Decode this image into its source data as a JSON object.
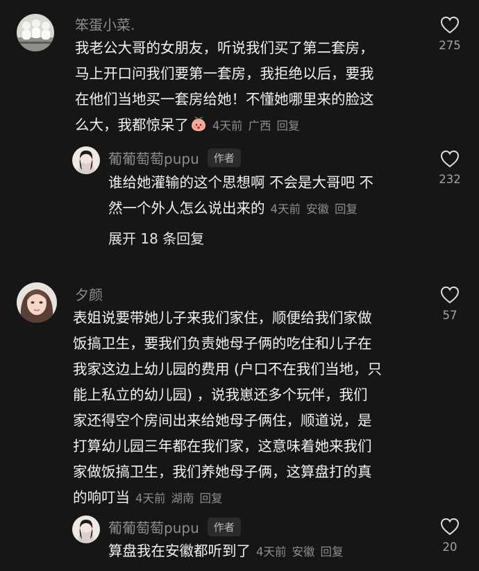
{
  "comments": [
    {
      "username": "笨蛋小菜.",
      "lines": [
        "我老公大哥的女朋友，听说我们买了第二套房，",
        "马上开口问我们要第一套房，我拒绝以后，要我",
        "在他们当地买一套房给她！不懂她哪里来的脸这",
        "么大，我都惊呆了"
      ],
      "time": "4天前",
      "location": "广西",
      "reply_label": "回复",
      "likes": "275",
      "emoji_icon": "peach-face-emoji"
    },
    {
      "username": "夕颜",
      "lines": [
        "表姐说要带她儿子来我们家住，顺便给我们家做",
        "饭搞卫生，要我们负责她母子俩的吃住和儿子在",
        "我家这边上幼儿园的费用 (户口不在我们当地，只",
        "能上私立的幼儿园) ，说我崽还多个玩伴，我们",
        "家还得空个房间出来给她母子俩住，顺道说，是",
        "打算幼儿园三年都在我们家，这意味着她来我们",
        "家做饭搞卫生，我们养她母子俩，这算盘打的真",
        "的响叮当"
      ],
      "time": "4天前",
      "location": "湖南",
      "reply_label": "回复",
      "likes": "57"
    }
  ],
  "replies": [
    {
      "username": "葡葡萄萄pupu",
      "author_tag": "作者",
      "lines": [
        "谁给她灌输的这个思想啊 不会是大哥吧 不",
        "然一个外人怎么说出来的"
      ],
      "time": "4天前",
      "location": "安徽",
      "reply_label": "回复",
      "likes": "232",
      "expand_label": "展开 18 条回复"
    },
    {
      "username": "葡葡萄萄pupu",
      "author_tag": "作者",
      "lines": [
        "算盘我在安徽都听到了"
      ],
      "time": "4天前",
      "location": "安徽",
      "reply_label": "回复",
      "likes": "20"
    }
  ],
  "colors": {
    "background": "#161616",
    "text": "#f2f2f2",
    "muted": "#8d8d8d"
  }
}
